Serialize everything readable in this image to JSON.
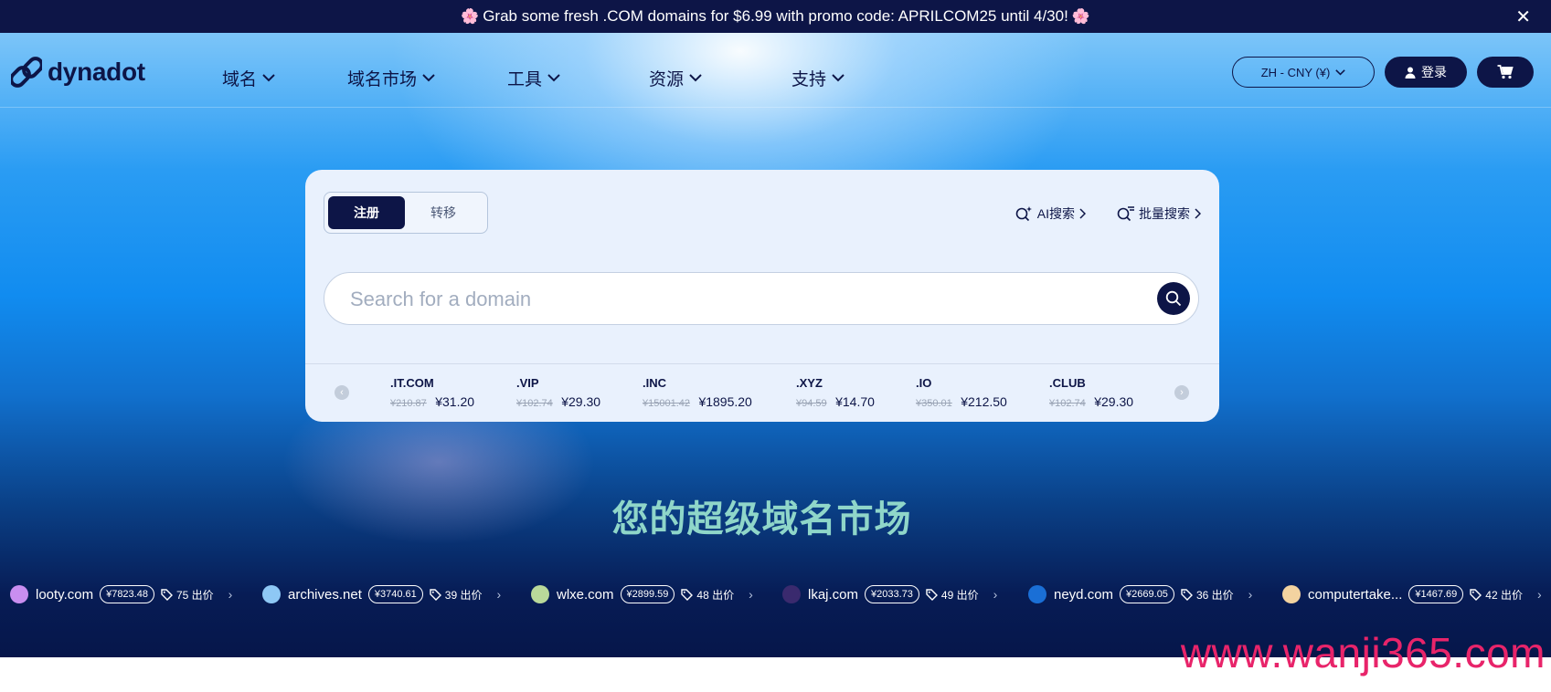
{
  "promo": {
    "text": "Grab some fresh .COM domains for $6.99 with promo code: APRILCOM25 until 4/30!",
    "flower_left": "🌸",
    "flower_right": "🌸",
    "close_label": "✕"
  },
  "logo": {
    "text": "dynadot"
  },
  "nav": {
    "items": [
      {
        "label": "域名"
      },
      {
        "label": "域名市场"
      },
      {
        "label": "工具"
      },
      {
        "label": "资源"
      },
      {
        "label": "支持"
      }
    ]
  },
  "header": {
    "lang_label": "ZH - CNY (¥)",
    "login_label": "登录"
  },
  "search_card": {
    "tabs": [
      {
        "label": "注册",
        "active": true
      },
      {
        "label": "转移",
        "active": false
      }
    ],
    "ai_search_label": "AI搜索",
    "bulk_search_label": "批量搜索",
    "placeholder": "Search for a domain"
  },
  "tlds": [
    {
      "name": ".IT.COM",
      "old_price": "¥210.87",
      "new_price": "¥31.20"
    },
    {
      "name": ".VIP",
      "old_price": "¥102.74",
      "new_price": "¥29.30"
    },
    {
      "name": ".INC",
      "old_price": "¥15001.42",
      "new_price": "¥1895.20"
    },
    {
      "name": ".XYZ",
      "old_price": "¥94.59",
      "new_price": "¥14.70"
    },
    {
      "name": ".IO",
      "old_price": "¥350.01",
      "new_price": "¥212.50"
    },
    {
      "name": ".CLUB",
      "old_price": "¥102.74",
      "new_price": "¥29.30"
    }
  ],
  "tagline": "您的超级域名市场",
  "marketplace": [
    {
      "domain": "looty.com",
      "price": "¥7823.48",
      "offers": "75 出价",
      "color": "#c98ef0"
    },
    {
      "domain": "archives.net",
      "price": "¥3740.61",
      "offers": "39 出价",
      "color": "#8ec8f5"
    },
    {
      "domain": "wlxe.com",
      "price": "¥2899.59",
      "offers": "48 出价",
      "color": "#b9d99a"
    },
    {
      "domain": "lkaj.com",
      "price": "¥2033.73",
      "offers": "49 出价",
      "color": "#3a2a6e"
    },
    {
      "domain": "neyd.com",
      "price": "¥2669.05",
      "offers": "36 出价",
      "color": "#1a6fd6"
    },
    {
      "domain": "computertake...",
      "price": "¥1467.69",
      "offers": "42 出价",
      "color": "#f3d3a0"
    }
  ],
  "watermark": "www.wanji365.com",
  "colors": {
    "navy": "#0d1547",
    "promo_flower": "#f06aa6",
    "tagline": "#8fd6c9",
    "watermark": "#e8246a"
  }
}
